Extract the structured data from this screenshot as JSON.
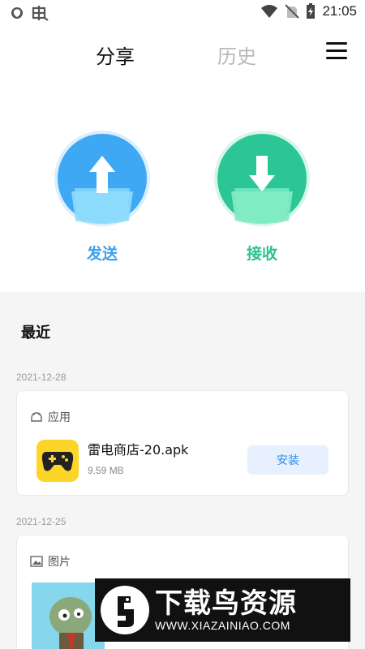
{
  "status_bar": {
    "time": "21:05",
    "icons": [
      "shield-icon",
      "bug-icon",
      "wifi-icon",
      "no-sim-icon",
      "battery-charging-icon"
    ]
  },
  "header": {
    "tabs": [
      {
        "label": "分享",
        "active": true
      },
      {
        "label": "历史",
        "active": false
      }
    ],
    "menu_icon": "hamburger-menu-icon"
  },
  "actions": {
    "send": {
      "label": "发送",
      "color": "#3aa0ee",
      "icon": "upload-folder-icon"
    },
    "receive": {
      "label": "接收",
      "color": "#29c191",
      "icon": "download-folder-icon"
    }
  },
  "recent": {
    "title": "最近",
    "groups": [
      {
        "date": "2021-12-28",
        "category": "应用",
        "category_icon": "android-icon",
        "file_name": "雷电商店-20.apk",
        "file_size": "9.59 MB",
        "action_label": "安装"
      },
      {
        "date": "2021-12-25",
        "category": "图片",
        "category_icon": "image-icon"
      }
    ]
  },
  "watermark": {
    "title": "下载鸟资源",
    "url": "WWW.XIAZAINIAO.COM"
  }
}
